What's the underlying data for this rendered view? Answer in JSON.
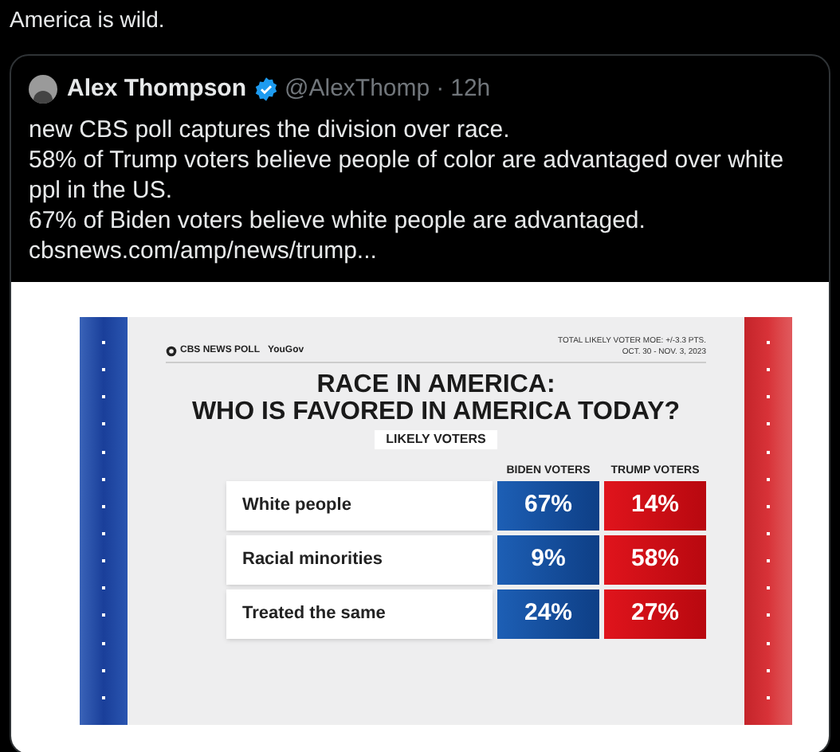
{
  "post": {
    "text": "America is wild."
  },
  "quote": {
    "author": "Alex Thompson",
    "verified": true,
    "handle": "@AlexThomp",
    "separator": "·",
    "time": "12h",
    "lines": [
      {
        "kind": "text",
        "text": "new CBS poll captures the division over race."
      },
      {
        "kind": "text",
        "text": "58% of Trump voters believe people of color are advantaged over white ppl in the US."
      },
      {
        "kind": "text",
        "text": "67% of Biden voters believe white people are advantaged."
      },
      {
        "kind": "link",
        "text": "cbsnews.com/amp/news/trump..."
      }
    ]
  },
  "graphic": {
    "brand": "CBS NEWS POLL",
    "partner": "YouGov",
    "moe": "TOTAL LIKELY VOTER MOE: +/-3.3 PTS.",
    "dates": "OCT. 30 - NOV. 3, 2023",
    "title_1": "RACE IN AMERICA:",
    "title_2": "WHO IS FAVORED IN AMERICA TODAY?",
    "subtitle": "LIKELY VOTERS",
    "columns": [
      "BIDEN VOTERS",
      "TRUMP VOTERS"
    ],
    "rows": [
      {
        "label": "White people",
        "values": [
          "67%",
          "14%"
        ]
      },
      {
        "label": "Racial minorities",
        "values": [
          "9%",
          "58%"
        ]
      },
      {
        "label": "Treated the same",
        "values": [
          "24%",
          "27%"
        ]
      }
    ]
  }
}
